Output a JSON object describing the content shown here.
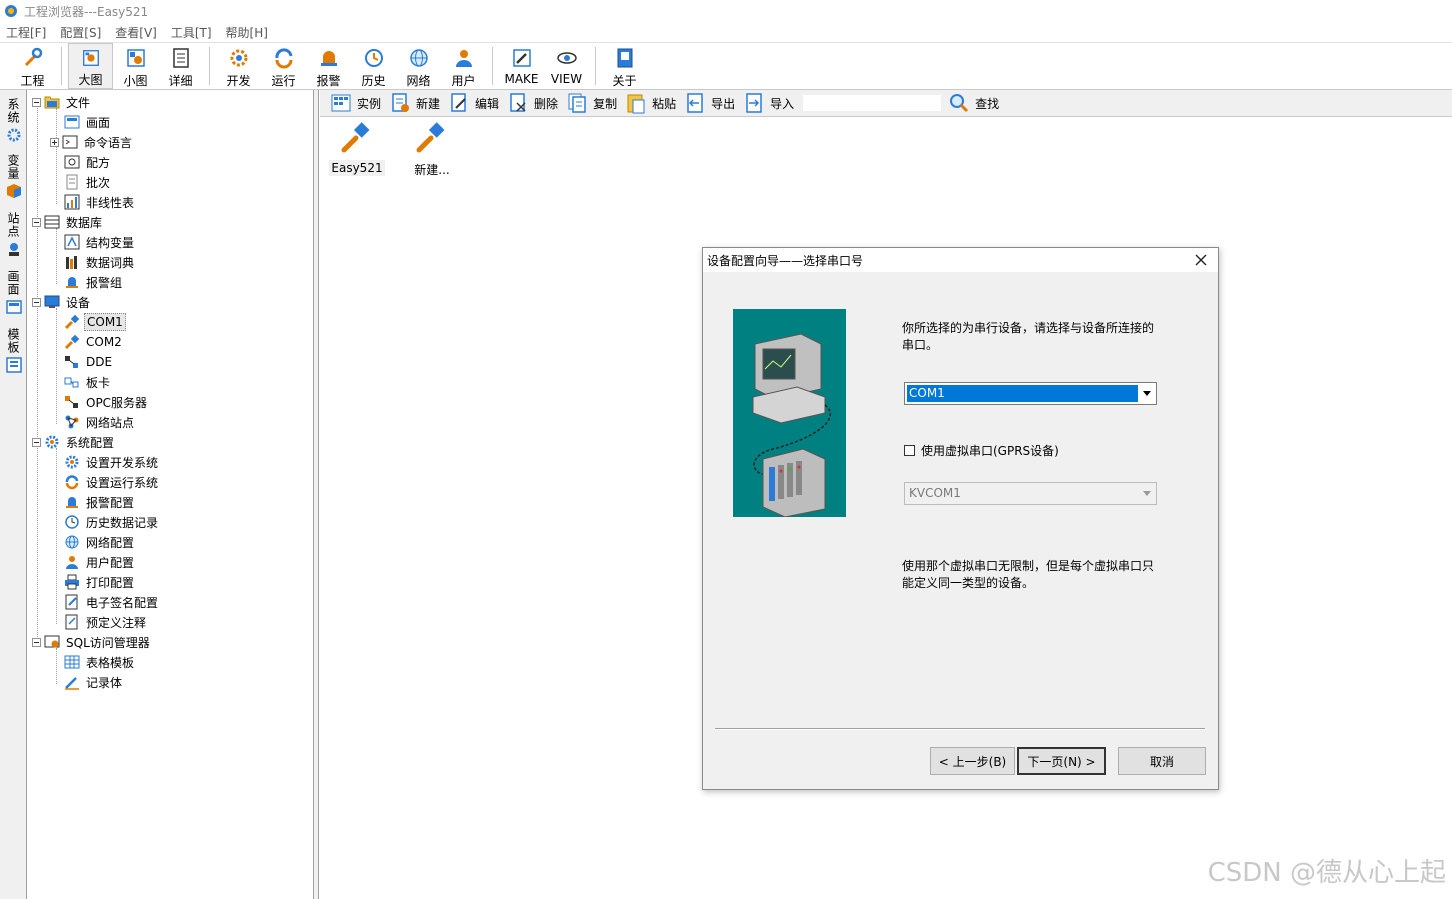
{
  "window": {
    "title": "工程浏览器---Easy521"
  },
  "menu": [
    "工程[F]",
    "配置[S]",
    "查看[V]",
    "工具[T]",
    "帮助[H]"
  ],
  "toolbar": {
    "project": "工程",
    "large_icon": "大图",
    "small_icon": "小图",
    "detail": "详细",
    "develop": "开发",
    "run": "运行",
    "alarm": "报警",
    "history": "历史",
    "network": "网络",
    "user": "用户",
    "make": "MAKE",
    "view": "VIEW",
    "about": "关于"
  },
  "vtabs": [
    "系统",
    "变量",
    "站点",
    "画面",
    "模板"
  ],
  "tree": {
    "file": "文件",
    "screen": "画面",
    "command": "命令语言",
    "recipe": "配方",
    "batch": "批次",
    "nonlinear": "非线性表",
    "database": "数据库",
    "struct_var": "结构变量",
    "data_dict": "数据词典",
    "alarm_group": "报警组",
    "devices": "设备",
    "com1": "COM1",
    "com2": "COM2",
    "dde": "DDE",
    "board": "板卡",
    "opc": "OPC服务器",
    "net_station": "网络站点",
    "sysconfig": "系统配置",
    "dev_sys": "设置开发系统",
    "run_sys": "设置运行系统",
    "alarm_cfg": "报警配置",
    "hist_cfg": "历史数据记录",
    "net_cfg": "网络配置",
    "user_cfg": "用户配置",
    "print_cfg": "打印配置",
    "esign_cfg": "电子签名配置",
    "predef_comment": "预定义注释",
    "sql": "SQL访问管理器",
    "table_tpl": "表格模板",
    "record": "记录体"
  },
  "rtoolbar": {
    "instance": "实例",
    "new": "新建",
    "edit": "编辑",
    "delete": "删除",
    "copy": "复制",
    "paste": "粘贴",
    "export": "导出",
    "import": "导入",
    "search_value": "",
    "find": "查找"
  },
  "devices": [
    {
      "label": "Easy521"
    },
    {
      "label": "新建..."
    }
  ],
  "dialog": {
    "title": "设备配置向导——选择串口号",
    "desc": "你所选择的为串行设备，请选择与设备所连接的串口。",
    "com_selected": "COM1",
    "checkbox_label": "使用虚拟串口(GPRS设备)",
    "virtual_com": "KVCOM1",
    "note": "使用那个虚拟串口无限制，但是每个虚拟串口只能定义同一类型的设备。",
    "prev": "< 上一步(B)",
    "next": "下一页(N) >",
    "cancel": "取消"
  },
  "watermark": "CSDN @德从心上起"
}
